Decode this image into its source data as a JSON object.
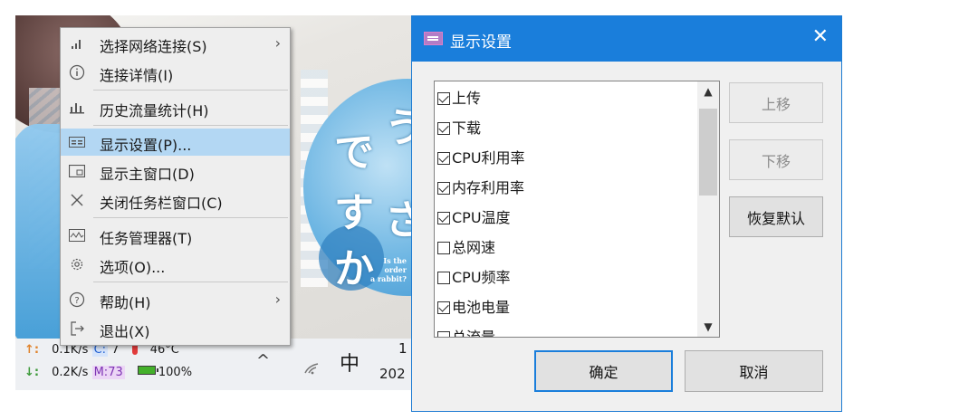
{
  "taskbar": {
    "up_arrow": "↑:",
    "up_speed": "0.1K/s",
    "cpu_label": "C:",
    "cpu_value": "7",
    "temp": "46°C",
    "down_arrow": "↓:",
    "down_speed": "0.2K/s",
    "mem_label": "M:73",
    "battery": "100%",
    "chevron": "^",
    "ime": "中",
    "clock_top": "1",
    "clock_bottom": "202"
  },
  "wallpaper": {
    "jp_1": "で",
    "jp_2": "う",
    "jp_3": "す",
    "jp_4": "さ",
    "jp_5": "か",
    "eng": [
      "Is the",
      "order",
      "a rabbit?"
    ]
  },
  "menu": {
    "items": [
      {
        "label": "选择网络连接(S)",
        "submenu": "›",
        "icon": "signal-icon"
      },
      {
        "label": "连接详情(I)",
        "icon": "info-icon"
      },
      {
        "label": "历史流量统计(H)",
        "icon": "bar-chart-icon"
      },
      {
        "label": "显示设置(P)...",
        "icon": "display-settings-icon"
      },
      {
        "label": "显示主窗口(D)",
        "icon": "window-icon"
      },
      {
        "label": "关闭任务栏窗口(C)",
        "icon": "close-icon"
      },
      {
        "label": "任务管理器(T)",
        "icon": "task-manager-icon"
      },
      {
        "label": "选项(O)...",
        "icon": "gear-icon"
      },
      {
        "label": "帮助(H)",
        "submenu": "›",
        "icon": "help-icon"
      },
      {
        "label": "退出(X)",
        "icon": "exit-icon"
      }
    ]
  },
  "dialog": {
    "title": "显示设置",
    "close": "✕",
    "items": [
      {
        "label": "上传",
        "checked": true
      },
      {
        "label": "下载",
        "checked": true
      },
      {
        "label": "CPU利用率",
        "checked": true
      },
      {
        "label": "内存利用率",
        "checked": true
      },
      {
        "label": "CPU温度",
        "checked": true
      },
      {
        "label": "总网速",
        "checked": false
      },
      {
        "label": "CPU频率",
        "checked": false
      },
      {
        "label": "电池电量",
        "checked": true
      },
      {
        "label": "总流量",
        "checked": false
      }
    ],
    "btn_move_up": "上移",
    "btn_move_down": "下移",
    "btn_restore": "恢复默认",
    "btn_ok": "确定",
    "btn_cancel": "取消"
  },
  "colors": {
    "title_bar": "#1a7edb",
    "menu_highlight": "#b3d7f3",
    "menu_bg": "#eeeeee",
    "dialog_bg": "#f0f0f0"
  }
}
